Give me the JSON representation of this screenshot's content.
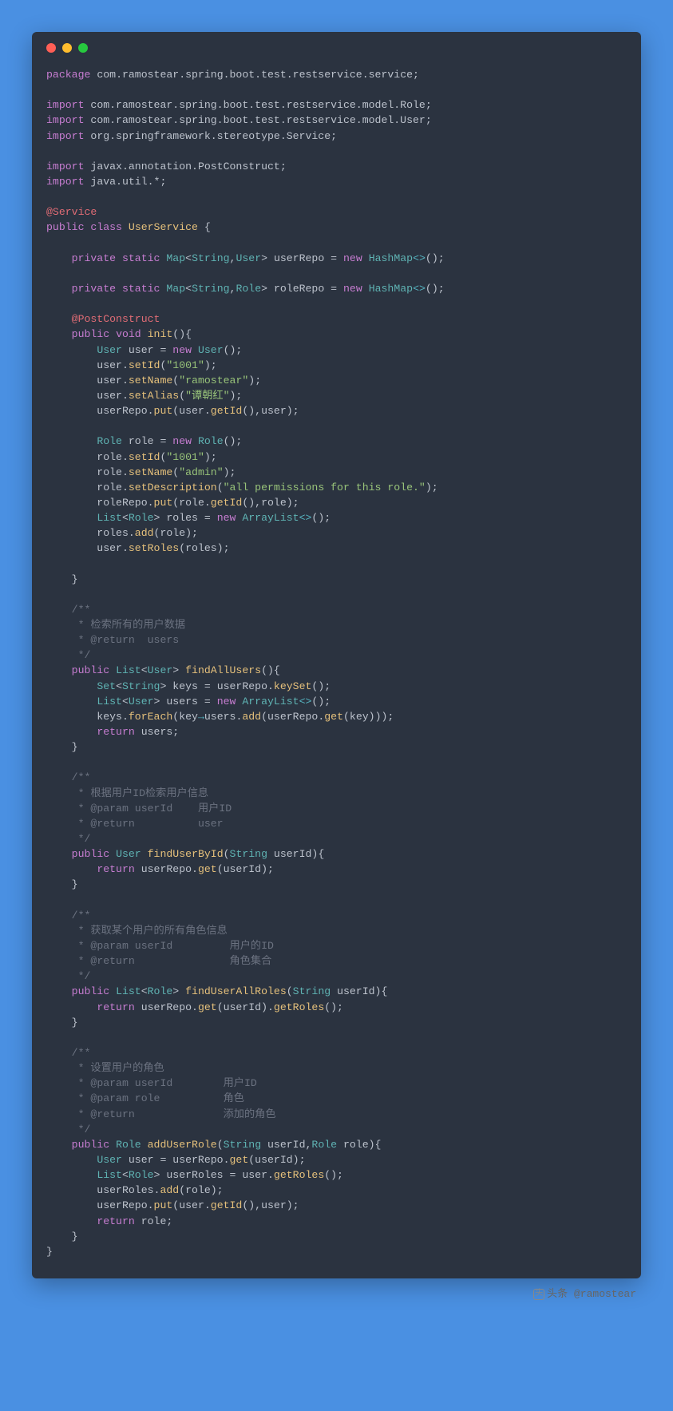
{
  "window": {
    "dots": [
      "red",
      "yellow",
      "green"
    ]
  },
  "code": {
    "package": "com.ramostear.spring.boot.test.restservice.service",
    "imports": [
      "com.ramostear.spring.boot.test.restservice.model.Role",
      "com.ramostear.spring.boot.test.restservice.model.User",
      "org.springframework.stereotype.Service",
      "javax.annotation.PostConstruct",
      "java.util.*"
    ],
    "classAnnotation": "@Service",
    "className": "UserService",
    "fields": [
      {
        "modifiers": "private static",
        "type": "Map<String,User>",
        "name": "userRepo",
        "init": "new HashMap<>()"
      },
      {
        "modifiers": "private static",
        "type": "Map<String,Role>",
        "name": "roleRepo",
        "init": "new HashMap<>()"
      }
    ],
    "methods": {
      "init": {
        "annotation": "@PostConstruct",
        "signature": "public void init()",
        "userId": "\"1001\"",
        "userName": "\"ramostear\"",
        "userAlias": "\"谭朝红\"",
        "roleId": "\"1001\"",
        "roleName": "\"admin\"",
        "roleDescription": "\"all permissions for this role.\""
      },
      "findAllUsers": {
        "doc": [
          "检索所有的用户数据",
          "@return  users"
        ],
        "signature": "public List<User> findAllUsers()"
      },
      "findUserById": {
        "doc": [
          "根据用户ID检索用户信息",
          "@param userId    用户ID",
          "@return          user"
        ],
        "signature": "public User findUserById(String userId)"
      },
      "findUserAllRoles": {
        "doc": [
          "获取某个用户的所有角色信息",
          "@param userId         用户的ID",
          "@return               角色集合"
        ],
        "signature": "public List<Role> findUserAllRoles(String userId)"
      },
      "addUserRole": {
        "doc": [
          "设置用户的角色",
          "@param userId        用户ID",
          "@param role          角色",
          "@return              添加的角色"
        ],
        "signature": "public Role addUserRole(String userId,Role role)"
      }
    }
  },
  "watermark": {
    "prefix": "头条",
    "handle": "@ramostear"
  }
}
